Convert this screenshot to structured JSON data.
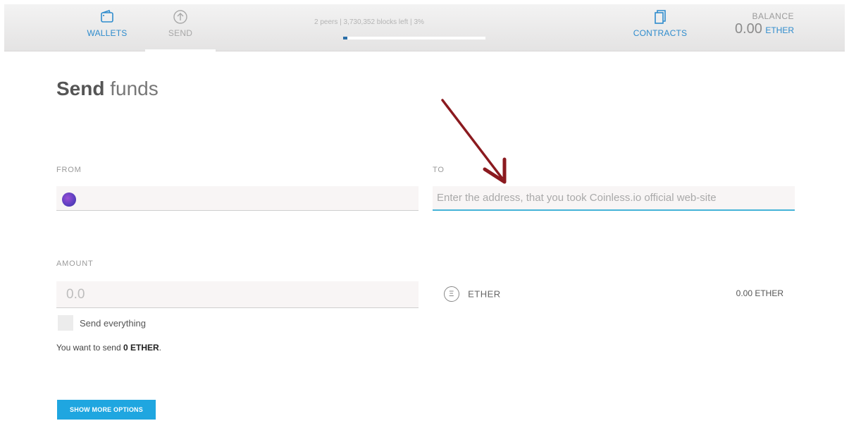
{
  "nav": {
    "wallets": {
      "label": "WALLETS",
      "icon": "wallet-icon"
    },
    "send": {
      "label": "SEND",
      "icon": "arrow-up-circle-icon"
    },
    "contracts": {
      "label": "CONTRACTS",
      "icon": "documents-icon"
    }
  },
  "status": {
    "peers": "2 peers",
    "blocks": "3,730,352 blocks left",
    "percent": "3%",
    "progress_fraction": 0.03
  },
  "balance": {
    "title": "BALANCE",
    "value": "0.00",
    "unit": "ETHER"
  },
  "page": {
    "title_bold": "Send",
    "title_light": "funds"
  },
  "form": {
    "from_label": "FROM",
    "to_label": "TO",
    "to_placeholder": "Enter the address, that you took Coinless.io official web-site",
    "amount_label": "AMOUNT",
    "amount_placeholder": "0.0",
    "currency": "ETHER",
    "account_balance": "0.00 ETHER",
    "send_everything": "Send everything",
    "summary_prefix": "You want to send",
    "summary_value": "0 ETHER",
    "summary_suffix": "."
  },
  "buttons": {
    "show_more_options": "SHOW MORE OPTIONS"
  },
  "colors": {
    "accent": "#2f8ccd",
    "button": "#1fa6e0",
    "focus_underline": "#45b3d8",
    "annotation_arrow": "#8b1a1f"
  }
}
